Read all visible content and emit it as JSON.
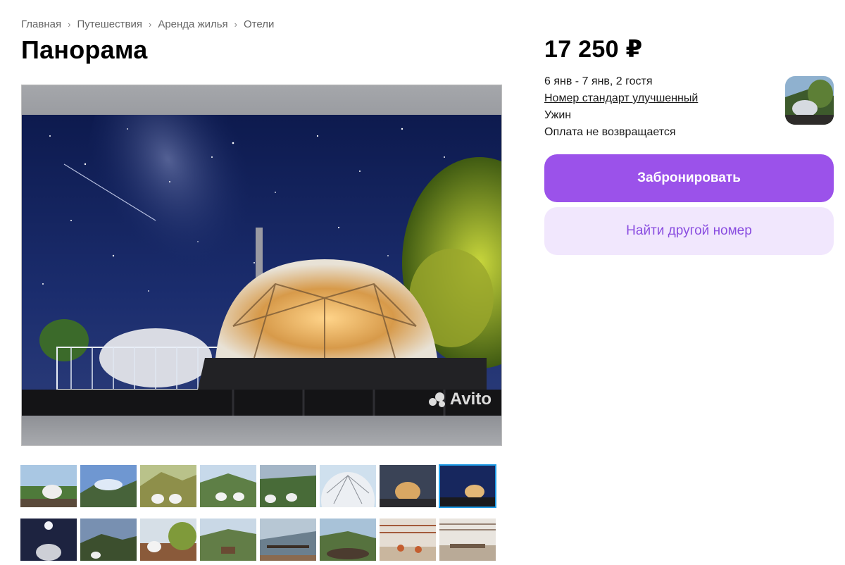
{
  "breadcrumb": [
    "Главная",
    "Путешествия",
    "Аренда жилья",
    "Отели"
  ],
  "title": "Панорама",
  "price": "17 250 ₽",
  "booking": {
    "dates": "6 янв - 7 янв, 2 гостя",
    "room": "Номер стандарт улучшенный",
    "meal": "Ужин",
    "refund": "Оплата не возвращается"
  },
  "buttons": {
    "book": "Забронировать",
    "find_other": "Найти другой номер"
  },
  "watermark": "Avito",
  "colors": {
    "accent": "#9b52ea",
    "accent_light": "#f1e7fd",
    "active_thumb": "#1e9be6"
  },
  "thumbnails": {
    "count_visible": 16,
    "active_index": 7
  }
}
